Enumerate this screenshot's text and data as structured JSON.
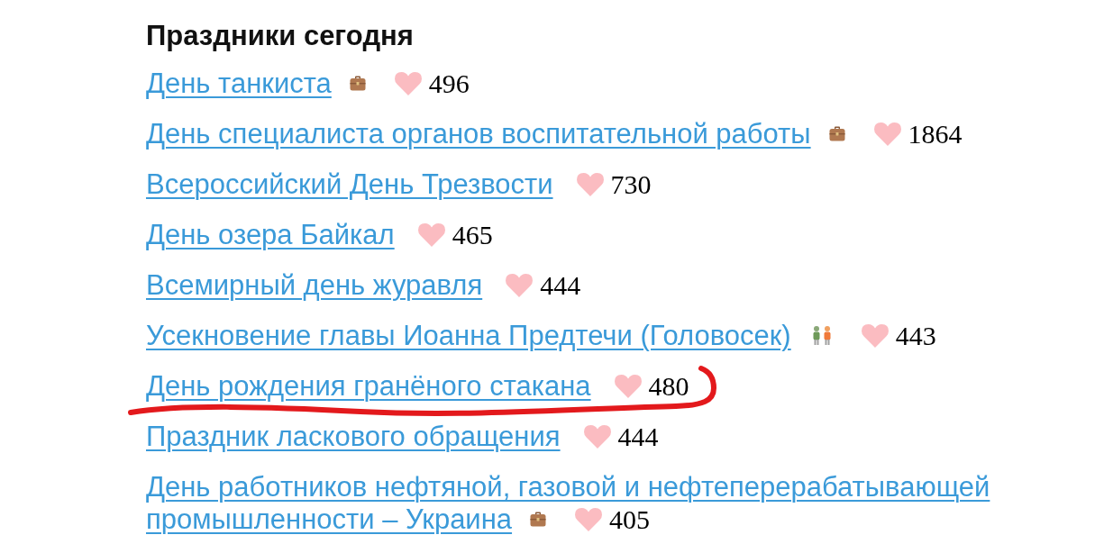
{
  "section": {
    "title": "Праздники сегодня"
  },
  "holidays": [
    {
      "name_lines": [
        "День танкиста"
      ],
      "kind": "work",
      "likes": "496",
      "marked": false
    },
    {
      "name_lines": [
        "День специалиста органов воспитательной работы"
      ],
      "kind": "work",
      "likes": "1864",
      "marked": false
    },
    {
      "name_lines": [
        "Всероссийский День Трезвости"
      ],
      "kind": "plain",
      "likes": "730",
      "marked": false
    },
    {
      "name_lines": [
        "День озера Байкал"
      ],
      "kind": "plain",
      "likes": "465",
      "marked": false
    },
    {
      "name_lines": [
        "Всемирный день журавля"
      ],
      "kind": "plain",
      "likes": "444",
      "marked": false
    },
    {
      "name_lines": [
        "Усекновение главы Иоанна Предтечи (Головосек)"
      ],
      "kind": "kids",
      "likes": "443",
      "marked": false
    },
    {
      "name_lines": [
        "День рождения гранёного стакана"
      ],
      "kind": "plain",
      "likes": "480",
      "marked": true
    },
    {
      "name_lines": [
        "Праздник ласкового обращения"
      ],
      "kind": "plain",
      "likes": "444",
      "marked": false
    },
    {
      "name_lines": [
        "День работников нефтяной, газовой и нефтеперерабатывающей",
        "промышленности – Украина"
      ],
      "kind": "work",
      "likes": "405",
      "marked": false
    }
  ]
}
